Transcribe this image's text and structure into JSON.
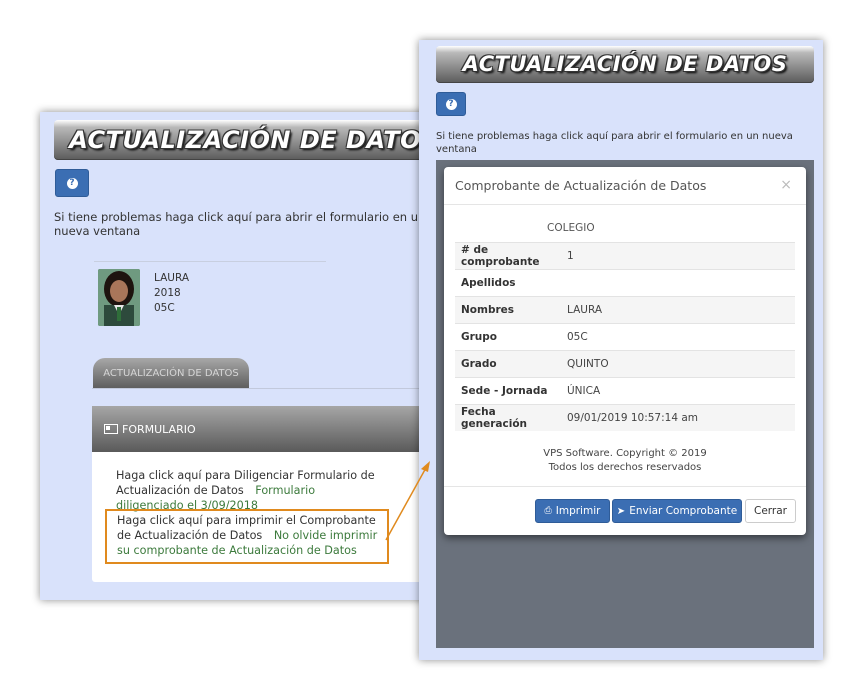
{
  "back": {
    "title": "ACTUALIZACIÓN DE DATOS",
    "help_text": "Si tiene problemas haga click aquí para abrir el formulario en un nueva ventana",
    "student": {
      "name": "LAURA",
      "year": "2018",
      "group": "05C"
    },
    "tab_label": "ACTUALIZACIÓN DE DATOS",
    "form_title": "FORMULARIO",
    "link1": "Haga click aquí para Diligenciar Formulario de Actualización de Datos",
    "status1": "Formulario diligenciado el 3/09/2018",
    "link2": "Haga click aquí para imprimir el Comprobante de Actualización de Datos",
    "status2": "No olvide imprimir su comprobante de Actualización de Datos"
  },
  "front": {
    "title": "ACTUALIZACIÓN DE DATOS",
    "help_text": "Si tiene problemas haga click aquí para abrir el formulario en un nueva ventana",
    "modal": {
      "title": "Comprobante de Actualización de Datos",
      "close": "×",
      "school": "COLEGIO",
      "rows": [
        {
          "label": "# de comprobante",
          "value": "1"
        },
        {
          "label": "Apellidos",
          "value": ""
        },
        {
          "label": "Nombres",
          "value": "LAURA"
        },
        {
          "label": "Grupo",
          "value": "05C"
        },
        {
          "label": "Grado",
          "value": "QUINTO"
        },
        {
          "label": "Sede - Jornada",
          "value": "ÚNICA"
        },
        {
          "label": "Fecha generación",
          "value": "09/01/2019 10:57:14 am"
        }
      ],
      "copyright": "VPS Software. Copyright © 2019",
      "rights": "Todos los derechos reservados",
      "btn_print": "Imprimir",
      "btn_send": "Enviar Comprobante",
      "btn_close": "Cerrar"
    }
  },
  "colors": {
    "panel_bg": "#d9e2fb",
    "button_blue": "#3b6eb3",
    "status_green": "#3c7a3c",
    "callout_orange": "#e08a1e",
    "overlay": "#6a717c"
  }
}
